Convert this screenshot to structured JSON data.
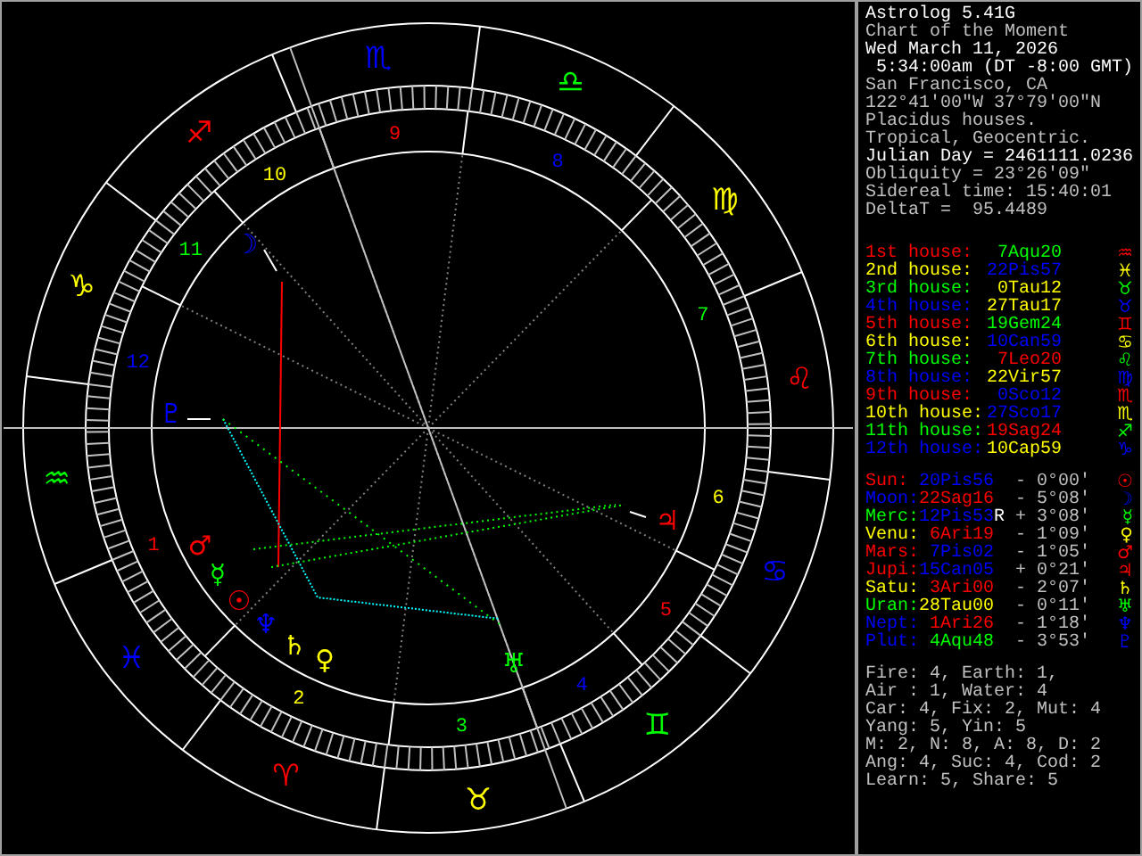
{
  "chart": {
    "house_numbers": [
      {
        "text": "1",
        "color": "#ff0000"
      },
      {
        "text": "2",
        "color": "#ffff00"
      },
      {
        "text": "3",
        "color": "#00ff00"
      },
      {
        "text": "4",
        "color": "#0000ff"
      },
      {
        "text": "5",
        "color": "#ff0000"
      },
      {
        "text": "6",
        "color": "#ffff00"
      },
      {
        "text": "7",
        "color": "#00ff00"
      },
      {
        "text": "8",
        "color": "#0000ff"
      },
      {
        "text": "9",
        "color": "#ff0000"
      },
      {
        "text": "10",
        "color": "#ffff00"
      },
      {
        "text": "11",
        "color": "#00ff00"
      },
      {
        "text": "12",
        "color": "#0000ff"
      }
    ],
    "signs": [
      {
        "glyph": "♈",
        "color": "#ff0000"
      },
      {
        "glyph": "♉",
        "color": "#ffff00"
      },
      {
        "glyph": "♊",
        "color": "#00ff00"
      },
      {
        "glyph": "♋",
        "color": "#0000ff"
      },
      {
        "glyph": "♌",
        "color": "#ff0000"
      },
      {
        "glyph": "♍",
        "color": "#ffff00"
      },
      {
        "glyph": "♎",
        "color": "#00ff00"
      },
      {
        "glyph": "♏",
        "color": "#0000ff"
      },
      {
        "glyph": "♐",
        "color": "#ff0000"
      },
      {
        "glyph": "♑",
        "color": "#ffff00"
      },
      {
        "glyph": "♒",
        "color": "#00ff00"
      },
      {
        "glyph": "♓",
        "color": "#0000ff"
      }
    ],
    "planets": [
      {
        "glyph": "☽",
        "color": "#0000ff"
      },
      {
        "glyph": "♇",
        "color": "#0000ff"
      },
      {
        "glyph": "♃",
        "color": "#ff0000"
      },
      {
        "glyph": "♂",
        "color": "#ff0000"
      },
      {
        "glyph": "☿",
        "color": "#00ff00"
      },
      {
        "glyph": "☉",
        "color": "#ff0000"
      },
      {
        "glyph": "♆",
        "color": "#0000ff"
      },
      {
        "glyph": "♄",
        "color": "#ffff00"
      },
      {
        "glyph": "♀",
        "color": "#ffff00"
      },
      {
        "glyph": "♅",
        "color": "#00ff00"
      }
    ]
  },
  "info": [
    {
      "text": "Astrolog 5.41G",
      "bright": true
    },
    {
      "text": "Chart of the Moment",
      "bright": false
    },
    {
      "text": "Wed March 11, 2026",
      "bright": true
    },
    {
      "text": " 5:34:00am (DT -8:00 GMT)",
      "bright": true
    },
    {
      "text": "San Francisco, CA",
      "bright": false
    },
    {
      "text": "122°41'00\"W 37°79'00\"N",
      "bright": false
    },
    {
      "text": "Placidus houses.",
      "bright": false
    },
    {
      "text": "Tropical, Geocentric.",
      "bright": false
    },
    {
      "text": "Julian Day = 2461111.0236",
      "bright": true
    },
    {
      "text": "Obliquity = 23°26'09\"",
      "bright": false
    },
    {
      "text": "Sidereal time: 15:40:01",
      "bright": false
    },
    {
      "text": "DeltaT =  95.4489",
      "bright": false
    }
  ],
  "houses": [
    {
      "label": {
        "text": "1st house:",
        "color": "#ff0000"
      },
      "position": {
        "text": "7Aqu20",
        "color": "#00ff00"
      },
      "glyph": "♒"
    },
    {
      "label": {
        "text": "2nd house:",
        "color": "#ffff00"
      },
      "position": {
        "text": "22Pis57",
        "color": "#0000ff"
      },
      "glyph": "♓"
    },
    {
      "label": {
        "text": "3rd house:",
        "color": "#00ff00"
      },
      "position": {
        "text": "0Tau12",
        "color": "#ffff00"
      },
      "glyph": "♉"
    },
    {
      "label": {
        "text": "4th house:",
        "color": "#0000ff"
      },
      "position": {
        "text": "27Tau17",
        "color": "#ffff00"
      },
      "glyph": "♉"
    },
    {
      "label": {
        "text": "5th house:",
        "color": "#ff0000"
      },
      "position": {
        "text": "19Gem24",
        "color": "#00ff00"
      },
      "glyph": "♊"
    },
    {
      "label": {
        "text": "6th house:",
        "color": "#ffff00"
      },
      "position": {
        "text": "10Can59",
        "color": "#0000ff"
      },
      "glyph": "♋"
    },
    {
      "label": {
        "text": "7th house:",
        "color": "#00ff00"
      },
      "position": {
        "text": "7Leo20",
        "color": "#ff0000"
      },
      "glyph": "♌"
    },
    {
      "label": {
        "text": "8th house:",
        "color": "#0000ff"
      },
      "position": {
        "text": "22Vir57",
        "color": "#ffff00"
      },
      "glyph": "♍"
    },
    {
      "label": {
        "text": "9th house:",
        "color": "#ff0000"
      },
      "position": {
        "text": "0Sco12",
        "color": "#0000ff"
      },
      "glyph": "♏"
    },
    {
      "label": {
        "text": "10th house:",
        "color": "#ffff00"
      },
      "position": {
        "text": "27Sco17",
        "color": "#0000ff"
      },
      "glyph": "♏"
    },
    {
      "label": {
        "text": "11th house:",
        "color": "#00ff00"
      },
      "position": {
        "text": "19Sag24",
        "color": "#ff0000"
      },
      "glyph": "♐"
    },
    {
      "label": {
        "text": "12th house:",
        "color": "#0000ff"
      },
      "position": {
        "text": "10Cap59",
        "color": "#ffff00"
      },
      "glyph": "♑"
    }
  ],
  "planets": [
    {
      "name": {
        "text": "Sun:",
        "color": "#ff0000"
      },
      "position": {
        "text": "20Pis56",
        "color": "#0000ff"
      },
      "aspect": "- 0°00'",
      "glyph": "☉"
    },
    {
      "name": {
        "text": "Moon:",
        "color": "#0000ff"
      },
      "position": {
        "text": "22Sag16",
        "color": "#ff0000"
      },
      "aspect": "- 5°08'",
      "glyph": "☽"
    },
    {
      "name": {
        "text": "Merc:",
        "color": "#00ff00"
      },
      "position": {
        "text": "12Pis53",
        "color": "#0000ff"
      },
      "retrograde": "R",
      "aspect": "+ 3°08'",
      "glyph": "☿"
    },
    {
      "name": {
        "text": "Venu:",
        "color": "#ffff00"
      },
      "position": {
        "text": "6Ari19",
        "color": "#ff0000"
      },
      "aspect": "- 1°09'",
      "glyph": "♀"
    },
    {
      "name": {
        "text": "Mars:",
        "color": "#ff0000"
      },
      "position": {
        "text": "7Pis02",
        "color": "#0000ff"
      },
      "aspect": "- 1°05'",
      "glyph": "♂"
    },
    {
      "name": {
        "text": "Jupi:",
        "color": "#ff0000"
      },
      "position": {
        "text": "15Can05",
        "color": "#0000ff"
      },
      "aspect": "+ 0°21'",
      "glyph": "♃"
    },
    {
      "name": {
        "text": "Satu:",
        "color": "#ffff00"
      },
      "position": {
        "text": "3Ari00",
        "color": "#ff0000"
      },
      "aspect": "- 2°07'",
      "glyph": "♄"
    },
    {
      "name": {
        "text": "Uran:",
        "color": "#00ff00"
      },
      "position": {
        "text": "28Tau00",
        "color": "#ffff00"
      },
      "aspect": "- 0°11'",
      "glyph": "♅"
    },
    {
      "name": {
        "text": "Nept:",
        "color": "#0000ff"
      },
      "position": {
        "text": "1Ari26",
        "color": "#ff0000"
      },
      "aspect": "- 1°18'",
      "glyph": "♆"
    },
    {
      "name": {
        "text": "Plut:",
        "color": "#0000ff"
      },
      "position": {
        "text": "4Aqu48",
        "color": "#00ff00"
      },
      "aspect": "- 3°53'",
      "glyph": "♇"
    }
  ],
  "stats": [
    "Fire: 4, Earth: 1,",
    "Air : 1, Water: 4",
    "Car: 4, Fix: 2, Mut: 4",
    "Yang: 5, Yin: 5",
    "M: 2, N: 8, A: 8, D: 2",
    "Ang: 4, Suc: 4, Cod: 2",
    "Learn: 5, Share: 5"
  ]
}
